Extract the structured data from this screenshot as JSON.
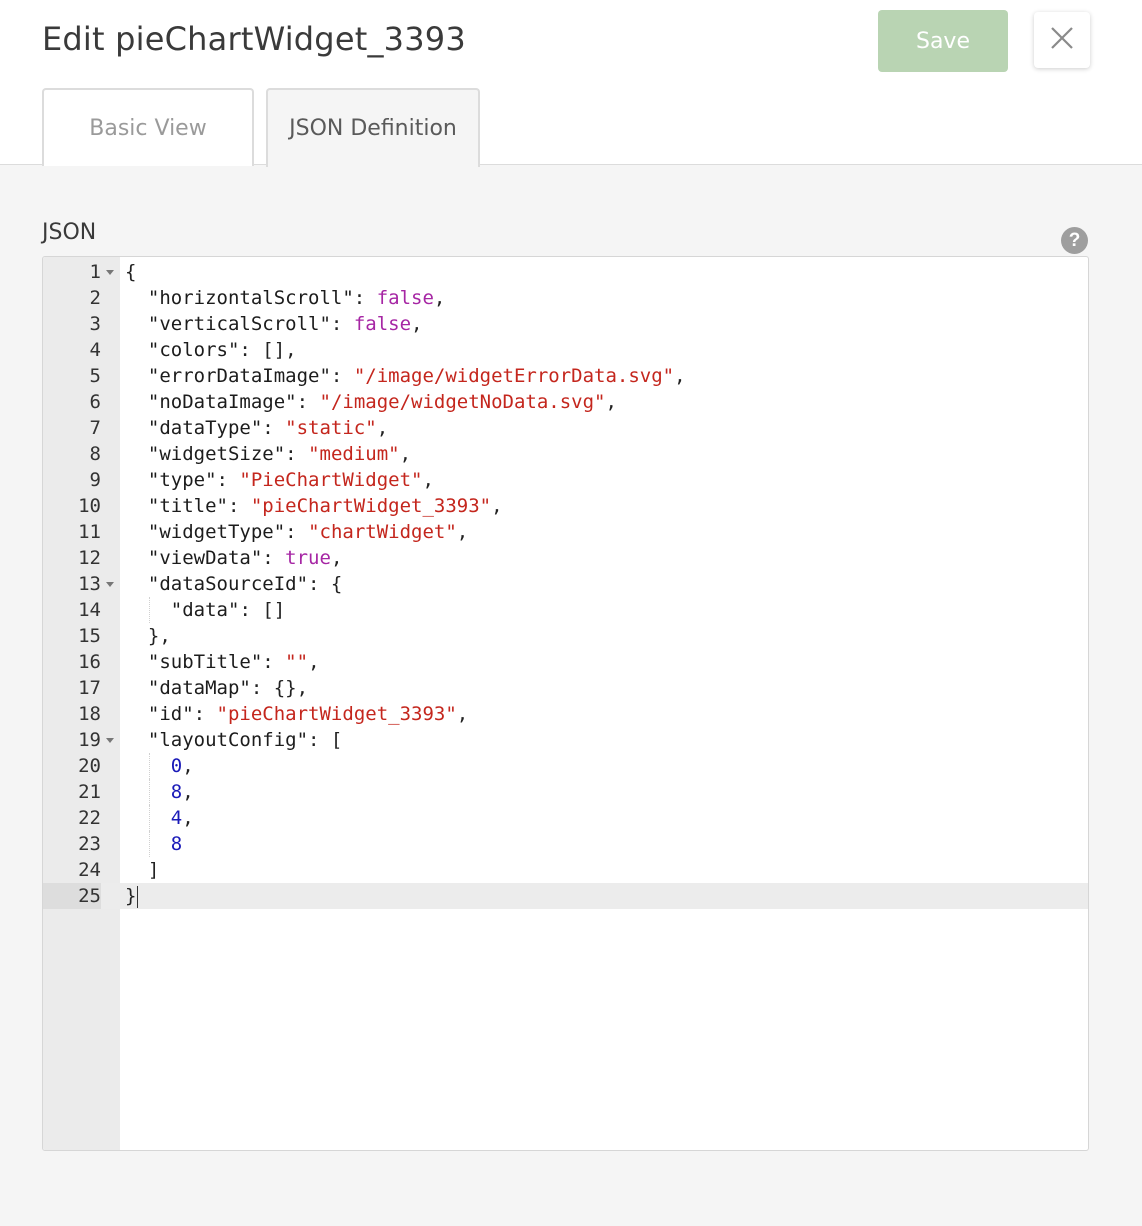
{
  "header": {
    "title": "Edit pieChartWidget_3393",
    "save_label": "Save",
    "close_icon": "close-icon"
  },
  "tabs": [
    {
      "label": "Basic View",
      "active": false
    },
    {
      "label": "JSON Definition",
      "active": true
    }
  ],
  "section": {
    "label": "JSON",
    "help_icon": "question-mark-icon",
    "help_glyph": "?"
  },
  "colors": {
    "save_disabled": "#b9d4b3",
    "string": "#c4261d",
    "boolean": "#a626a4",
    "number": "#1a1ab8"
  },
  "editor": {
    "active_line": 25,
    "lines": [
      {
        "n": "1",
        "fold": true,
        "indent": 0,
        "tokens": [
          [
            "p",
            "{"
          ]
        ]
      },
      {
        "n": "2",
        "indent": 1,
        "tokens": [
          [
            "k",
            "\"horizontalScroll\""
          ],
          [
            "p",
            ": "
          ],
          [
            "b",
            "false"
          ],
          [
            "p",
            ","
          ]
        ]
      },
      {
        "n": "3",
        "indent": 1,
        "tokens": [
          [
            "k",
            "\"verticalScroll\""
          ],
          [
            "p",
            ": "
          ],
          [
            "b",
            "false"
          ],
          [
            "p",
            ","
          ]
        ]
      },
      {
        "n": "4",
        "indent": 1,
        "tokens": [
          [
            "k",
            "\"colors\""
          ],
          [
            "p",
            ": [],"
          ]
        ]
      },
      {
        "n": "5",
        "indent": 1,
        "tokens": [
          [
            "k",
            "\"errorDataImage\""
          ],
          [
            "p",
            ": "
          ],
          [
            "s",
            "\"/image/widgetErrorData.svg\""
          ],
          [
            "p",
            ","
          ]
        ]
      },
      {
        "n": "6",
        "indent": 1,
        "tokens": [
          [
            "k",
            "\"noDataImage\""
          ],
          [
            "p",
            ": "
          ],
          [
            "s",
            "\"/image/widgetNoData.svg\""
          ],
          [
            "p",
            ","
          ]
        ]
      },
      {
        "n": "7",
        "indent": 1,
        "tokens": [
          [
            "k",
            "\"dataType\""
          ],
          [
            "p",
            ": "
          ],
          [
            "s",
            "\"static\""
          ],
          [
            "p",
            ","
          ]
        ]
      },
      {
        "n": "8",
        "indent": 1,
        "tokens": [
          [
            "k",
            "\"widgetSize\""
          ],
          [
            "p",
            ": "
          ],
          [
            "s",
            "\"medium\""
          ],
          [
            "p",
            ","
          ]
        ]
      },
      {
        "n": "9",
        "indent": 1,
        "tokens": [
          [
            "k",
            "\"type\""
          ],
          [
            "p",
            ": "
          ],
          [
            "s",
            "\"PieChartWidget\""
          ],
          [
            "p",
            ","
          ]
        ]
      },
      {
        "n": "10",
        "indent": 1,
        "tokens": [
          [
            "k",
            "\"title\""
          ],
          [
            "p",
            ": "
          ],
          [
            "s",
            "\"pieChartWidget_3393\""
          ],
          [
            "p",
            ","
          ]
        ]
      },
      {
        "n": "11",
        "indent": 1,
        "tokens": [
          [
            "k",
            "\"widgetType\""
          ],
          [
            "p",
            ": "
          ],
          [
            "s",
            "\"chartWidget\""
          ],
          [
            "p",
            ","
          ]
        ]
      },
      {
        "n": "12",
        "indent": 1,
        "tokens": [
          [
            "k",
            "\"viewData\""
          ],
          [
            "p",
            ": "
          ],
          [
            "b",
            "true"
          ],
          [
            "p",
            ","
          ]
        ]
      },
      {
        "n": "13",
        "fold": true,
        "indent": 1,
        "tokens": [
          [
            "k",
            "\"dataSourceId\""
          ],
          [
            "p",
            ": {"
          ]
        ]
      },
      {
        "n": "14",
        "indent": 2,
        "tokens": [
          [
            "k",
            "\"data\""
          ],
          [
            "p",
            ": []"
          ]
        ]
      },
      {
        "n": "15",
        "indent": 1,
        "tokens": [
          [
            "p",
            "},"
          ]
        ]
      },
      {
        "n": "16",
        "indent": 1,
        "tokens": [
          [
            "k",
            "\"subTitle\""
          ],
          [
            "p",
            ": "
          ],
          [
            "s",
            "\"\""
          ],
          [
            "p",
            ","
          ]
        ]
      },
      {
        "n": "17",
        "indent": 1,
        "tokens": [
          [
            "k",
            "\"dataMap\""
          ],
          [
            "p",
            ": {},"
          ]
        ]
      },
      {
        "n": "18",
        "indent": 1,
        "tokens": [
          [
            "k",
            "\"id\""
          ],
          [
            "p",
            ": "
          ],
          [
            "s",
            "\"pieChartWidget_3393\""
          ],
          [
            "p",
            ","
          ]
        ]
      },
      {
        "n": "19",
        "fold": true,
        "indent": 1,
        "tokens": [
          [
            "k",
            "\"layoutConfig\""
          ],
          [
            "p",
            ": ["
          ]
        ]
      },
      {
        "n": "20",
        "indent": 2,
        "tokens": [
          [
            "n",
            "0"
          ],
          [
            "p",
            ","
          ]
        ]
      },
      {
        "n": "21",
        "indent": 2,
        "tokens": [
          [
            "n",
            "8"
          ],
          [
            "p",
            ","
          ]
        ]
      },
      {
        "n": "22",
        "indent": 2,
        "tokens": [
          [
            "n",
            "4"
          ],
          [
            "p",
            ","
          ]
        ]
      },
      {
        "n": "23",
        "indent": 2,
        "tokens": [
          [
            "n",
            "8"
          ]
        ]
      },
      {
        "n": "24",
        "indent": 1,
        "tokens": [
          [
            "p",
            "]"
          ]
        ]
      },
      {
        "n": "25",
        "indent": 0,
        "tokens": [
          [
            "p",
            "}"
          ]
        ],
        "cursor": true
      }
    ]
  }
}
